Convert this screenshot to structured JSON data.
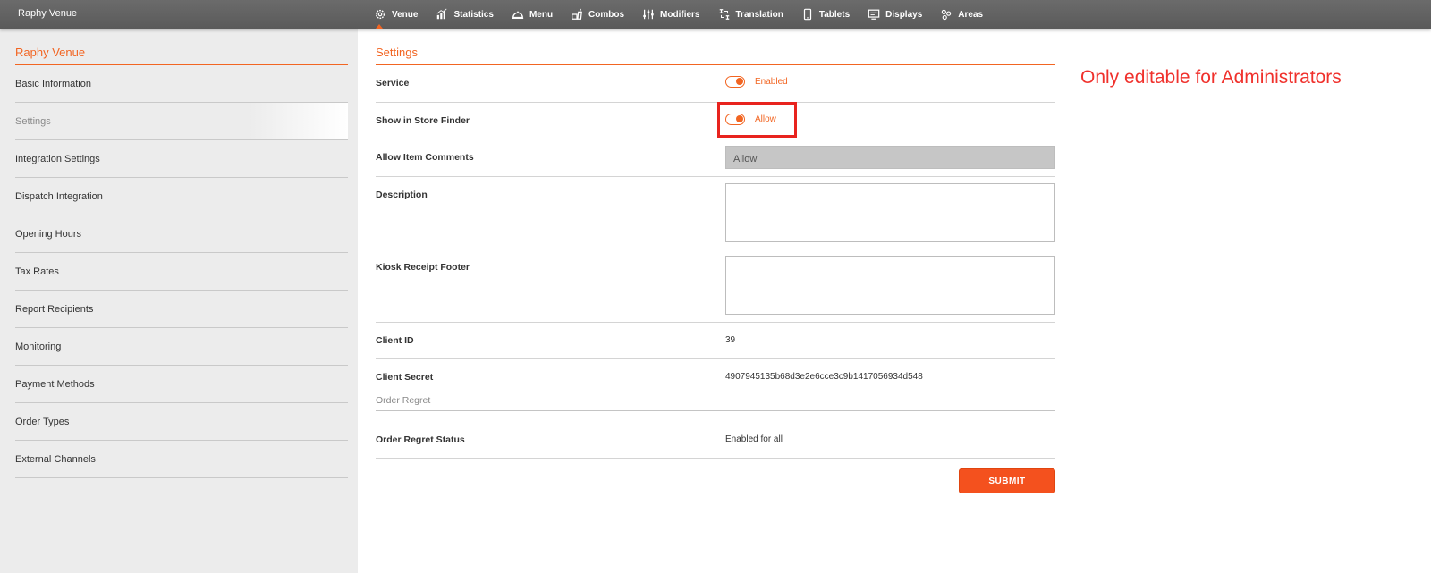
{
  "app": {
    "brand": "Raphy Venue"
  },
  "nav": [
    {
      "label": "Venue",
      "icon": "gear-icon",
      "active": true
    },
    {
      "label": "Statistics",
      "icon": "bar-chart-icon"
    },
    {
      "label": "Menu",
      "icon": "cloche-icon"
    },
    {
      "label": "Combos",
      "icon": "combo-icon"
    },
    {
      "label": "Modifiers",
      "icon": "sliders-icon"
    },
    {
      "label": "Translation",
      "icon": "translate-icon"
    },
    {
      "label": "Tablets",
      "icon": "tablet-icon"
    },
    {
      "label": "Displays",
      "icon": "display-icon"
    },
    {
      "label": "Areas",
      "icon": "areas-icon"
    }
  ],
  "sidebar": {
    "title": "Raphy Venue",
    "items": [
      {
        "label": "Basic Information"
      },
      {
        "label": "Settings",
        "active": true
      },
      {
        "label": "Integration Settings"
      },
      {
        "label": "Dispatch Integration"
      },
      {
        "label": "Opening Hours"
      },
      {
        "label": "Tax Rates"
      },
      {
        "label": "Report Recipients"
      },
      {
        "label": "Monitoring"
      },
      {
        "label": "Payment Methods"
      },
      {
        "label": "Order Types"
      },
      {
        "label": "External Channels"
      }
    ]
  },
  "settings": {
    "title": "Settings",
    "service": {
      "label": "Service",
      "toggle_text": "Enabled",
      "on": true
    },
    "store_finder": {
      "label": "Show in Store Finder",
      "toggle_text": "Allow",
      "on": true
    },
    "item_comments": {
      "label": "Allow Item Comments",
      "value": "Allow"
    },
    "description": {
      "label": "Description",
      "value": ""
    },
    "kiosk_footer": {
      "label": "Kiosk Receipt Footer",
      "value": ""
    },
    "client_id": {
      "label": "Client ID",
      "value": "39"
    },
    "client_secret": {
      "label": "Client Secret",
      "value": "4907945135b68d3e2e6cce3c9b1417056934d548"
    },
    "order_regret_heading": "Order Regret",
    "order_regret_status": {
      "label": "Order Regret Status",
      "value": "Enabled for all"
    },
    "submit_label": "SUBMIT"
  },
  "annotation": {
    "text": "Only editable for Administrators",
    "color": "#f0312c"
  },
  "colors": {
    "accent": "#f26522",
    "topbar": "#5f5f5f",
    "sidebar_bg": "#ececec"
  }
}
